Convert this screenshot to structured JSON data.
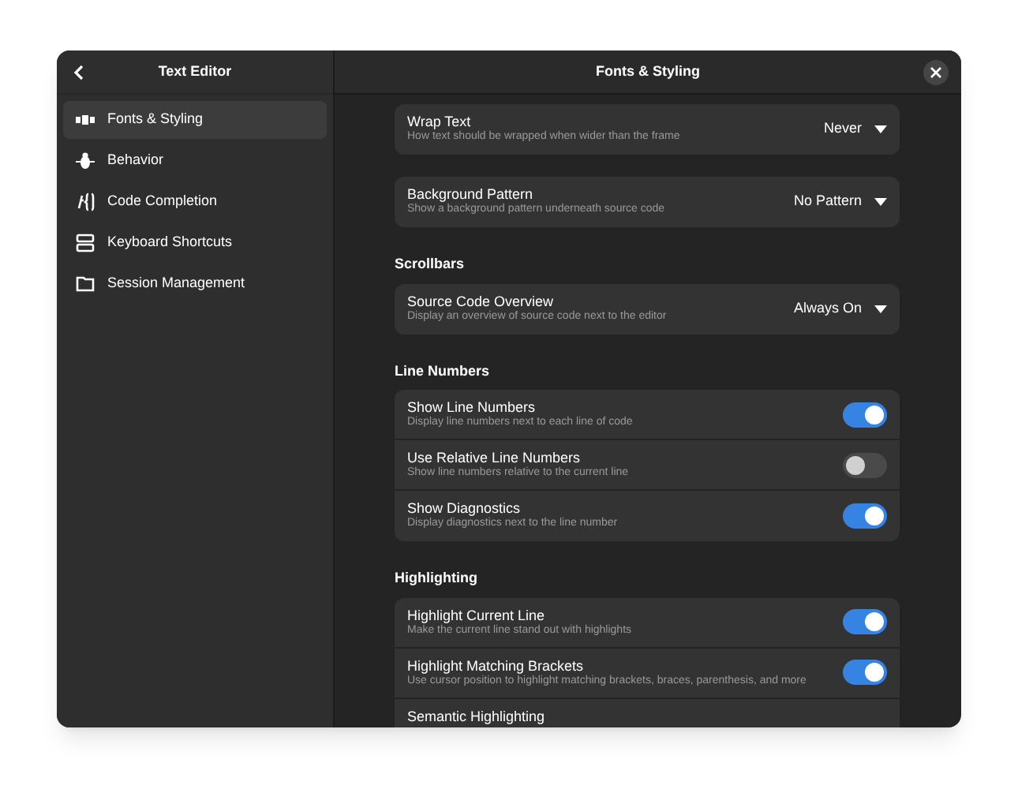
{
  "sidebar": {
    "title": "Text Editor",
    "items": [
      {
        "label": "Fonts & Styling",
        "selected": true
      },
      {
        "label": "Behavior",
        "selected": false
      },
      {
        "label": "Code Completion",
        "selected": false
      },
      {
        "label": "Keyboard Shortcuts",
        "selected": false
      },
      {
        "label": "Session Management",
        "selected": false
      }
    ]
  },
  "window": {
    "title": "Fonts & Styling"
  },
  "sections": [
    {
      "rows": [
        {
          "kind": "dropdown",
          "title": "Wrap Text",
          "subtitle": "How text should be wrapped when wider than the frame",
          "value": "Never"
        }
      ]
    },
    {
      "rows": [
        {
          "kind": "dropdown",
          "title": "Background Pattern",
          "subtitle": "Show a background pattern underneath source code",
          "value": "No Pattern"
        }
      ]
    },
    {
      "heading": "Scrollbars",
      "rows": [
        {
          "kind": "dropdown",
          "title": "Source Code Overview",
          "subtitle": "Display an overview of source code next to the editor",
          "value": "Always On"
        }
      ]
    },
    {
      "heading": "Line Numbers",
      "rows": [
        {
          "kind": "switch",
          "title": "Show Line Numbers",
          "subtitle": "Display line numbers next to each line of code",
          "on": true
        },
        {
          "kind": "switch",
          "title": "Use Relative Line Numbers",
          "subtitle": "Show line numbers relative to the current line",
          "on": false
        },
        {
          "kind": "switch",
          "title": "Show Diagnostics",
          "subtitle": "Display diagnostics next to the line number",
          "on": true
        }
      ]
    },
    {
      "heading": "Highlighting",
      "rows": [
        {
          "kind": "switch",
          "title": "Highlight Current Line",
          "subtitle": "Make the current line stand out with highlights",
          "on": true
        },
        {
          "kind": "switch",
          "title": "Highlight Matching Brackets",
          "subtitle": "Use cursor position to highlight matching brackets, braces, parenthesis, and more",
          "on": true
        },
        {
          "kind": "switch",
          "title": "Semantic Highlighting"
        }
      ]
    }
  ]
}
